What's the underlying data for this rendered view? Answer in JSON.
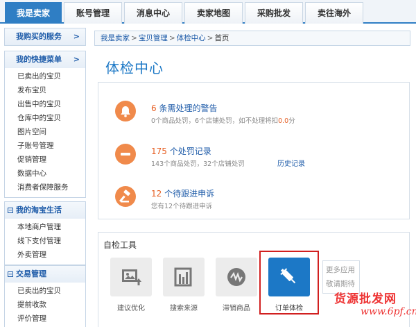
{
  "nav": {
    "tabs": [
      "我是卖家",
      "账号管理",
      "消息中心",
      "卖家地图",
      "采购批发",
      "卖往海外"
    ]
  },
  "sidebar": {
    "bought": {
      "title": "我购买的服务",
      "arrow": ">"
    },
    "quick": {
      "title": "我的快捷菜单",
      "arrow": ">",
      "items": [
        "已卖出的宝贝",
        "发布宝贝",
        "出售中的宝贝",
        "仓库中的宝贝",
        "图片空间",
        "子账号管理",
        "促销管理",
        "数据中心",
        "消费者保障服务"
      ]
    },
    "life": {
      "toggle": "−",
      "title": "我的淘宝生活",
      "items": [
        "本地商户管理",
        "线下支付管理",
        "外卖管理"
      ]
    },
    "trade": {
      "toggle": "−",
      "title": "交易管理",
      "items": [
        "已卖出的宝贝",
        "提前收款",
        "评价管理"
      ]
    }
  },
  "breadcrumb": {
    "items": [
      "我是卖家",
      "宝贝管理",
      "体检中心",
      "首页"
    ],
    "separator": ">"
  },
  "page": {
    "title": "体检中心"
  },
  "alerts": [
    {
      "icon": "bell-icon",
      "count": "6",
      "text": "条需处理的警告",
      "detail_prefix": "0个商品处罚，6个店铺处罚，如不处理将扣",
      "detail_value": "0.0",
      "detail_suffix": "分"
    },
    {
      "icon": "minus-icon",
      "count": "175",
      "text": "个处罚记录",
      "detail": "143个商品处罚，32个店铺处罚",
      "link": "历史记录"
    },
    {
      "icon": "gavel-icon",
      "count": "12",
      "text": "个待跟进申诉",
      "detail": "您有12个待跟进申诉"
    }
  ],
  "tools": {
    "title": "自检工具",
    "items": [
      {
        "label": "建议优化",
        "icon": "image-upload-icon"
      },
      {
        "label": "搜索来源",
        "icon": "building-icon"
      },
      {
        "label": "滞销商品",
        "icon": "chart-circle-icon"
      },
      {
        "label": "订单体检",
        "icon": "syringe-icon"
      }
    ],
    "more": {
      "line1": "更多应用",
      "line2": "敬请期待"
    }
  },
  "watermark": {
    "text": "货源批发网",
    "sub": "www.6pf.cn"
  },
  "colors": {
    "accent": "#2f7ec4",
    "link": "#1c5aa8",
    "warning": "#f08a4b",
    "highlight": "#d11f1f"
  }
}
